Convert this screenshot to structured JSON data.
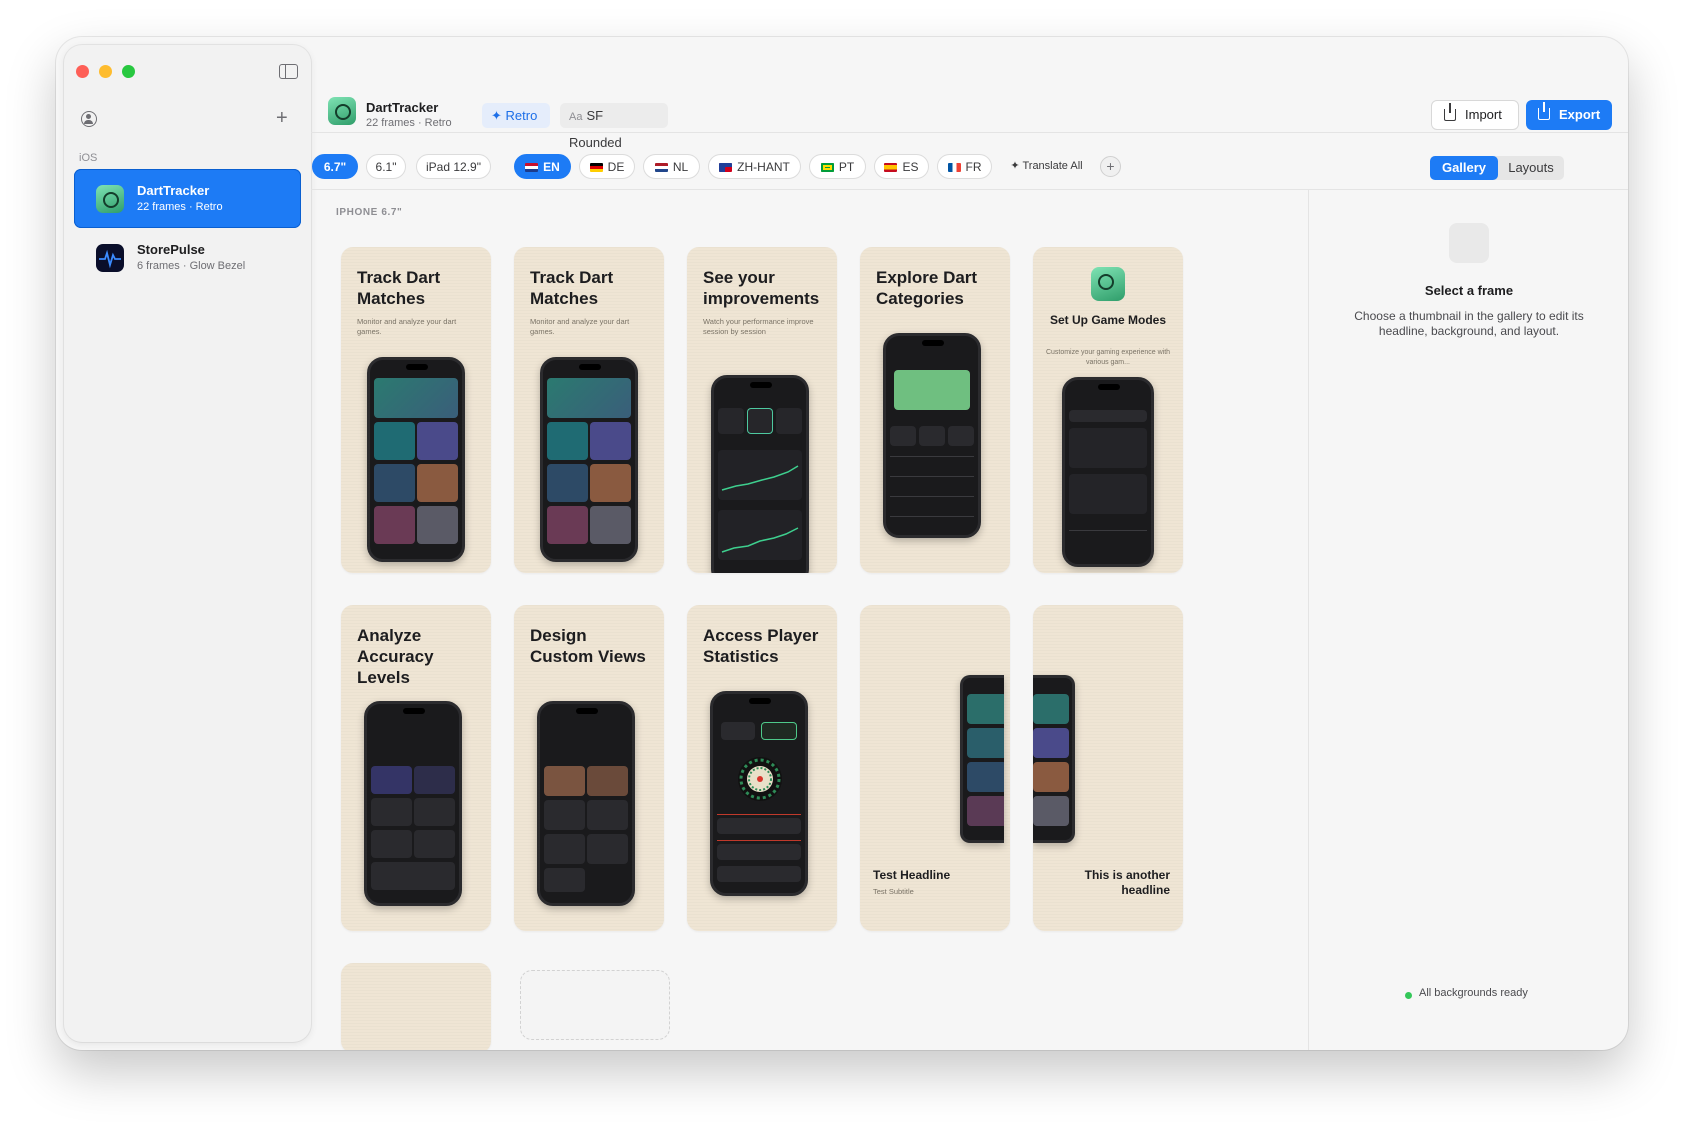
{
  "sidebar": {
    "section_label": "iOS",
    "add_symbol": "+",
    "projects": [
      {
        "name": "DartTracker",
        "subtitle": "22 frames · Retro",
        "icon": "dart-app-icon"
      },
      {
        "name": "StorePulse",
        "subtitle": "6 frames · Glow Bezel",
        "icon": "pulse-app-icon"
      }
    ]
  },
  "header": {
    "app_name": "DartTracker",
    "app_subtitle": "22 frames · Retro",
    "style_chip": "Retro",
    "font_chip_prefix": "Aa",
    "font_chip": "SF Rounded",
    "import_label": "Import",
    "export_label": "Export"
  },
  "devices": [
    "6.7\"",
    "6.1\"",
    "iPad 12.9\""
  ],
  "languages": [
    "EN",
    "DE",
    "NL",
    "ZH-HANT",
    "PT",
    "ES",
    "FR"
  ],
  "translate_all": "Translate All",
  "add_language": "+",
  "view_toggle": {
    "gallery": "Gallery",
    "layouts": "Layouts"
  },
  "gallery": {
    "section_label": "IPHONE 6.7\"",
    "frames": [
      {
        "title": "Track Dart Matches",
        "subtitle": "Monitor and analyze your dart games."
      },
      {
        "title": "Track Dart Matches",
        "subtitle": "Monitor and analyze your dart games."
      },
      {
        "title": "See your improvements",
        "subtitle": "Watch your performance improve session by session"
      },
      {
        "title": "Explore Dart Categories",
        "subtitle": ""
      },
      {
        "title": "Set Up Game Modes",
        "subtitle": "Customize your gaming experience with various gam..."
      },
      {
        "title": "Analyze Accuracy Levels",
        "subtitle": ""
      },
      {
        "title": "Design Custom Views",
        "subtitle": ""
      },
      {
        "title": "Access Player Statistics",
        "subtitle": ""
      },
      {
        "title": "Test Headline",
        "subtitle": "Test Subtitle"
      },
      {
        "title": "This is another headline",
        "subtitle": ""
      }
    ]
  },
  "inspector": {
    "title": "Select a frame",
    "description": "Choose a thumbnail in the gallery to edit its headline, background, and layout.",
    "status": "All backgrounds ready",
    "status_color": "#34c759"
  },
  "colors": {
    "accent": "#1d7bf5",
    "frame_bg": "#efe5d4"
  }
}
